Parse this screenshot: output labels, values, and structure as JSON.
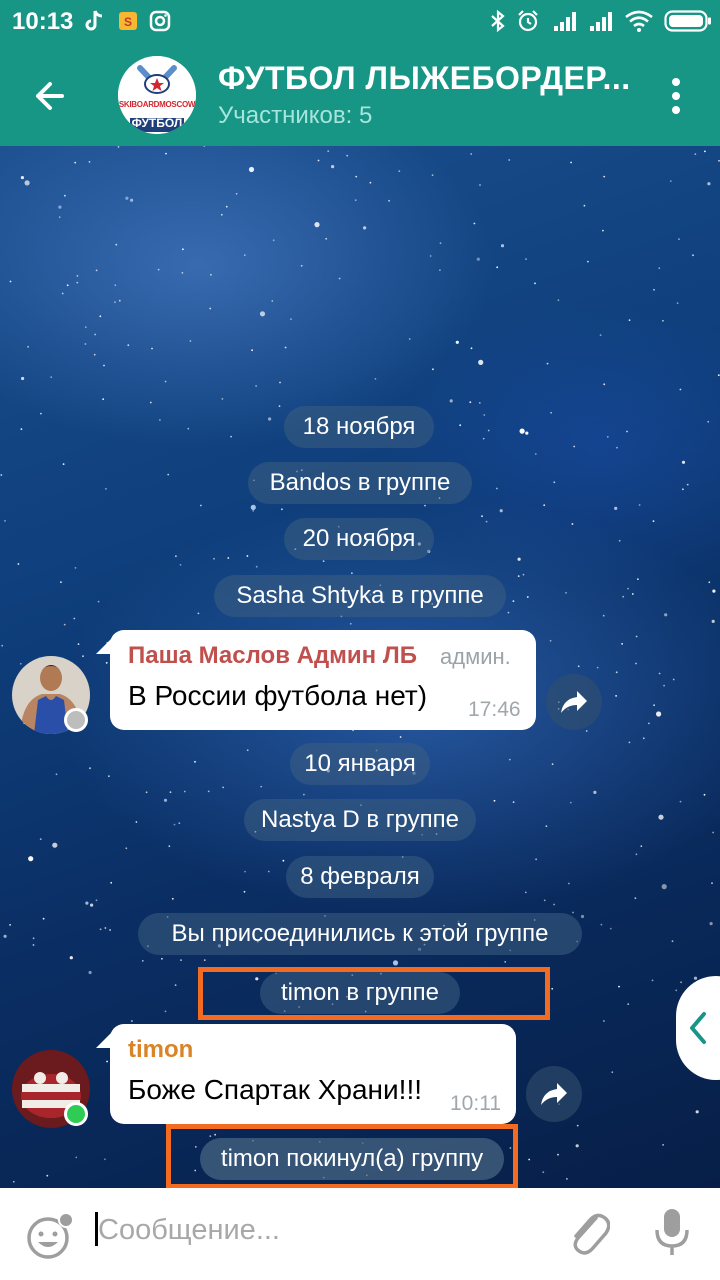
{
  "status_bar": {
    "time": "10:13",
    "left_icons": [
      "tiktok-icon",
      "notification-app-icon",
      "instagram-icon"
    ],
    "right_icons": [
      "bluetooth-icon",
      "alarm-icon",
      "signal-icon",
      "signal-icon",
      "wifi-icon",
      "battery-icon"
    ]
  },
  "header": {
    "title": "ФУТБОЛ ЛЫЖЕБОРДЕР...",
    "subtitle": "Участников: 5",
    "avatar_icon": "skiboard-football-logo",
    "avatar_logo_top": "SKIBOARDMOSCOW",
    "avatar_logo_bottom": "ФУТБОЛ"
  },
  "messages": {
    "date_1": "18 ноября",
    "event_1": "Bandos в группе",
    "date_2": "20 ноября",
    "event_2": "Sasha Shtyka в группе",
    "msg_1": {
      "author": "Паша Маслов Админ ЛБ",
      "role": "админ.",
      "text": "В России футбола нет)",
      "time": "17:46"
    },
    "date_3": "10 января",
    "event_3": "Nastya D в группе",
    "date_4": "8 февраля",
    "event_4": "Вы присоединились к этой группе",
    "event_5": "timon в группе",
    "msg_2": {
      "author": "timon",
      "text": "Боже Спартак Храни!!!",
      "time": "10:11"
    },
    "event_6": "timon покинул(а) группу"
  },
  "input": {
    "placeholder": "Сообщение..."
  },
  "colors": {
    "header_bg": "#179585",
    "subtitle": "#a6e5dc",
    "admin_name": "#c0504d",
    "timon_name": "#d98428",
    "highlight": "#f26b21",
    "online": "#2ecc55"
  }
}
